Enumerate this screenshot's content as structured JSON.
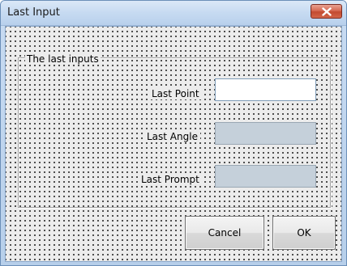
{
  "window": {
    "title": "Last Input"
  },
  "icons": {
    "close": "close-icon"
  },
  "colors": {
    "close_button": "#c34a2f",
    "disabled_field": "#c5d0da",
    "client_background": "#ececec"
  },
  "group": {
    "label": "The last inputs"
  },
  "fields": {
    "last_point": {
      "label": "Last Point",
      "value": ""
    },
    "last_angle": {
      "label": "Last Angle",
      "value": ""
    },
    "last_prompt": {
      "label": "Last Prompt",
      "value": ""
    }
  },
  "buttons": {
    "cancel": "Cancel",
    "ok": "OK"
  }
}
